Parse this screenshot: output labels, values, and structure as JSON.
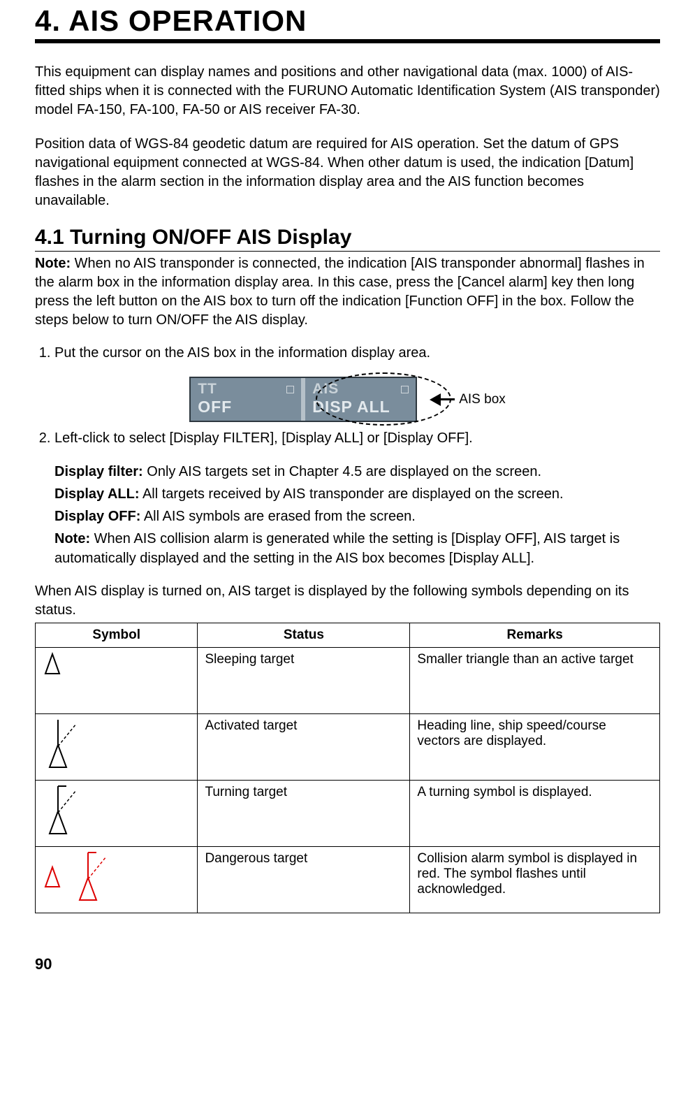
{
  "chapter": {
    "title": "4.   AIS OPERATION"
  },
  "intro": {
    "p1": "This equipment can display names and positions and other navigational data (max. 1000) of AIS-fitted ships when it is connected with the FURUNO Automatic Identification System (AIS transponder) model FA-150, FA-100, FA-50 or AIS receiver FA-30.",
    "p2": "Position data of WGS-84 geodetic datum are required for AIS operation. Set the datum of GPS navigational equipment connected at WGS-84. When other datum is used, the indication [Datum] flashes in the alarm section in the information display area and the AIS function becomes unavailable."
  },
  "section": {
    "num_title": "4.1  Turning ON/OFF AIS Display",
    "note_label": "Note:",
    "note_text": " When no AIS transponder is connected, the indication [AIS transponder abnormal] flashes in the alarm box in the information display area. In this case, press the [Cancel alarm] key then long press the left button on the AIS box to turn off the indication [Function OFF] in the box. Follow the steps below to turn ON/OFF the AIS display."
  },
  "steps": {
    "s1": "Put the cursor on the AIS box in the information display area.",
    "s2": "Left-click to select [Display FILTER], [Display ALL] or [Display OFF]."
  },
  "fig": {
    "tt_l1": "TT",
    "tt_l2": "OFF",
    "ais_l1": "AIS",
    "ais_l2": "DISP ALL",
    "callout": "AIS box"
  },
  "opts": {
    "filter_label": "Display filter:",
    "filter_text": " Only AIS targets set in Chapter 4.5 are displayed on the screen.",
    "all_label": "Display ALL:",
    "all_text": " All targets received by AIS transponder are displayed on the screen.",
    "off_label": "Display OFF:",
    "off_text": " All AIS symbols are erased from the screen.",
    "note2_label": "Note:",
    "note2_text": " When AIS collision alarm is generated while the setting is [Display OFF], AIS target is automatically displayed and the setting in the AIS box becomes [Display ALL]."
  },
  "table_intro": "When AIS display is turned on, AIS target is displayed by the following symbols depending on its status.",
  "tbl": {
    "h1": "Symbol",
    "h2": "Status",
    "h3": "Remarks",
    "r1": {
      "status": "Sleeping target",
      "remarks": "Smaller triangle than an active target"
    },
    "r2": {
      "status": "Activated target",
      "remarks": "Heading line, ship speed/course vectors are displayed."
    },
    "r3": {
      "status": "Turning target",
      "remarks": "A turning symbol is displayed."
    },
    "r4": {
      "status": "Dangerous target",
      "remarks": "Collision alarm symbol is displayed in red. The symbol flashes until acknowledged."
    }
  },
  "page_number": "90"
}
